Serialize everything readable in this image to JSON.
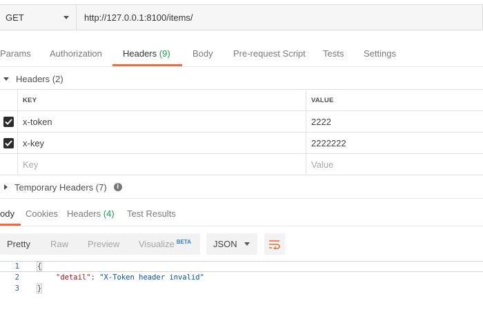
{
  "request": {
    "method": "GET",
    "url": "http://127.0.0.1:8100/items/"
  },
  "request_tabs": [
    {
      "label": "Params"
    },
    {
      "label": "Authorization"
    },
    {
      "label": "Headers",
      "count": "(9)"
    },
    {
      "label": "Body"
    },
    {
      "label": "Pre-request Script"
    },
    {
      "label": "Tests"
    },
    {
      "label": "Settings"
    }
  ],
  "headers_section": {
    "title": "Headers",
    "count": "(2)",
    "columns": {
      "key": "KEY",
      "value": "VALUE"
    },
    "rows": [
      {
        "checked": true,
        "key": "x-token",
        "value": "2222"
      },
      {
        "checked": true,
        "key": "x-key",
        "value": "2222222"
      }
    ],
    "placeholder": {
      "key": "Key",
      "value": "Value"
    }
  },
  "temporary_headers": {
    "title": "Temporary Headers",
    "count": "(7)",
    "info_icon": "info-icon"
  },
  "response_tabs": [
    {
      "label": "ody"
    },
    {
      "label": "Cookies"
    },
    {
      "label": "Headers",
      "count": "(4)"
    },
    {
      "label": "Test Results"
    }
  ],
  "view_options": {
    "pretty": "Pretty",
    "raw": "Raw",
    "preview": "Preview",
    "visualize": "Visualize",
    "beta": "BETA",
    "format": "JSON",
    "wrap_icon": "wrap-lines-icon"
  },
  "code": {
    "line_numbers": [
      "1",
      "2",
      "3"
    ],
    "open_brace": "{",
    "key": "\"detail\"",
    "colon": ": ",
    "value": "\"X-Token header invalid\"",
    "close_brace": "}"
  },
  "colors": {
    "accent": "#f26b3a",
    "count_green": "#1c9b58",
    "beta_blue": "#2d7fd5"
  }
}
